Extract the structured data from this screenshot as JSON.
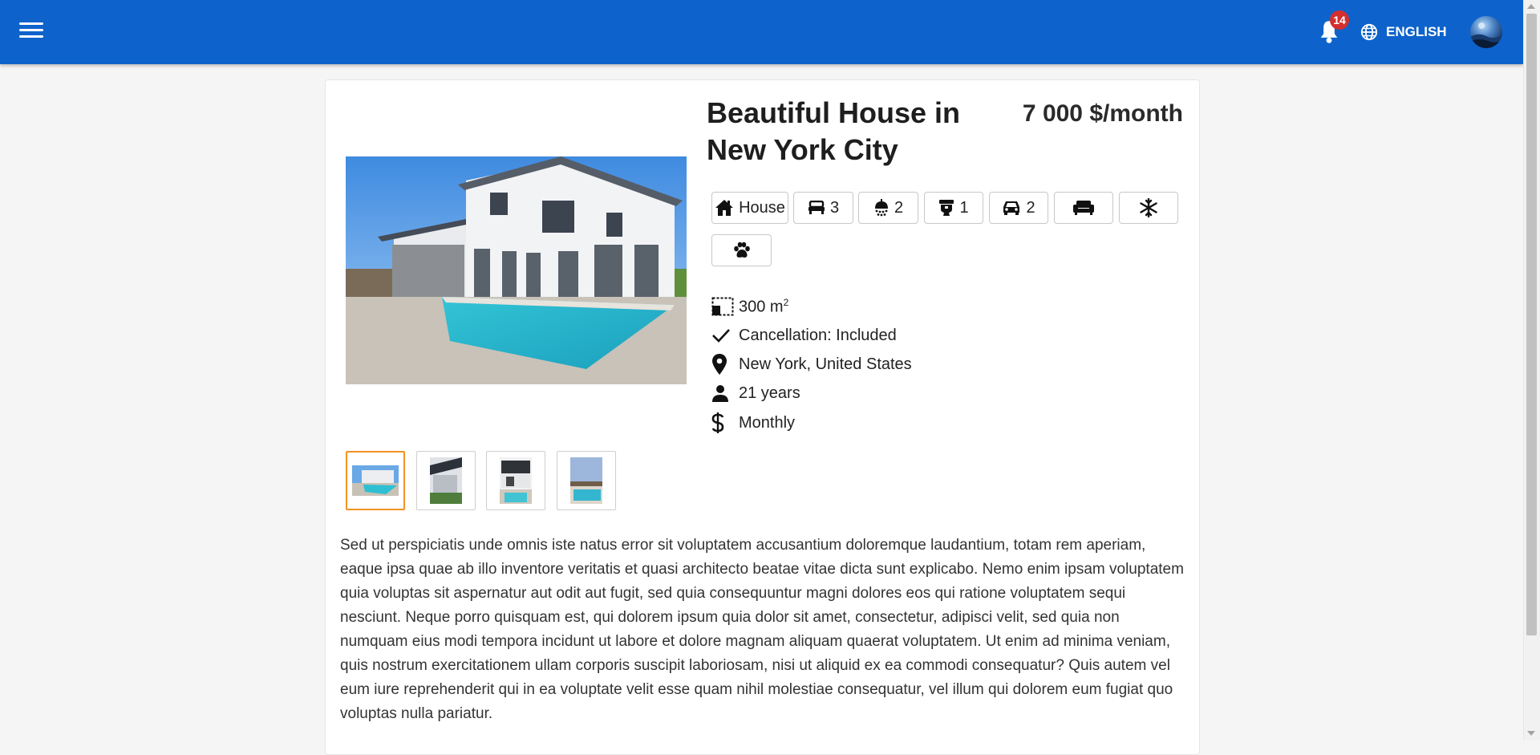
{
  "header": {
    "notifications_count": "14",
    "language_label": "ENGLISH",
    "icons": [
      "menu-icon",
      "bell-icon",
      "globe-icon",
      "avatar"
    ],
    "color": "#0d63cb"
  },
  "listing": {
    "title": "Beautiful House in New York City",
    "price": "7 000 $/month",
    "chips": [
      {
        "icon": "house-icon",
        "label": "House"
      },
      {
        "icon": "bed-icon",
        "label": "3"
      },
      {
        "icon": "shower-icon",
        "label": "2"
      },
      {
        "icon": "toilet-icon",
        "label": "1"
      },
      {
        "icon": "car-icon",
        "label": "2"
      },
      {
        "icon": "sofa-icon",
        "label": ""
      },
      {
        "icon": "snowflake-icon",
        "label": ""
      },
      {
        "icon": "paw-icon",
        "label": ""
      }
    ],
    "details": {
      "area_value": "300 m",
      "area_unit_sup": "2",
      "cancellation": "Cancellation: Included",
      "location": "New York, United States",
      "min_age": "21 years",
      "rental_term": "Monthly"
    },
    "thumbnails_count": 4,
    "selected_thumbnail": 0,
    "accent_color": "#f39222",
    "description": "Sed ut perspiciatis unde omnis iste natus error sit voluptatem accusantium doloremque laudantium, totam rem aperiam, eaque ipsa quae ab illo inventore veritatis et quasi architecto beatae vitae dicta sunt explicabo. Nemo enim ipsam voluptatem quia voluptas sit aspernatur aut odit aut fugit, sed quia consequuntur magni dolores eos qui ratione voluptatem sequi nesciunt. Neque porro quisquam est, qui dolorem ipsum quia dolor sit amet, consectetur, adipisci velit, sed quia non numquam eius modi tempora incidunt ut labore et dolore magnam aliquam quaerat voluptatem. Ut enim ad minima veniam, quis nostrum exercitationem ullam corporis suscipit laboriosam, nisi ut aliquid ex ea commodi consequatur? Quis autem vel eum iure reprehenderit qui in ea voluptate velit esse quam nihil molestiae consequatur, vel illum qui dolorem eum fugiat quo voluptas nulla pariatur."
  }
}
